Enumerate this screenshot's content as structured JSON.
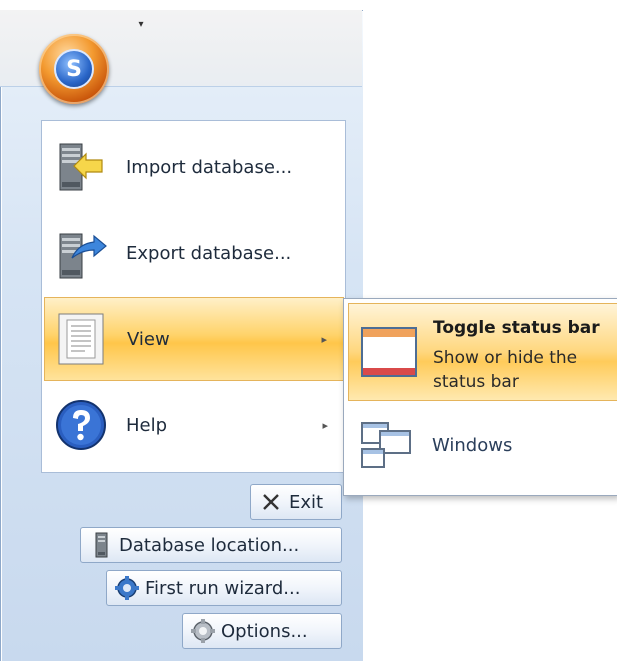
{
  "quick_access": {
    "dropdown_glyph": "▾"
  },
  "app_button": {
    "logo": "S"
  },
  "menu": {
    "items": [
      {
        "label": "Import database...",
        "icon": "import-database-icon"
      },
      {
        "label": "Export database...",
        "icon": "export-database-icon"
      },
      {
        "label": "View",
        "icon": "view-document-icon",
        "has_submenu": true,
        "arrow": "▸"
      },
      {
        "label": "Help",
        "icon": "help-icon",
        "has_submenu": true,
        "arrow": "▸"
      }
    ]
  },
  "bottom_buttons": {
    "exit": "Exit",
    "database_location": "Database location...",
    "first_run_wizard": "First run wizard...",
    "options": "Options..."
  },
  "submenu_view": {
    "items": [
      {
        "title": "Toggle status bar",
        "description": "Show or hide the status bar",
        "icon": "status-bar-window-icon"
      },
      {
        "title": "Windows",
        "icon": "windows-icon"
      }
    ]
  },
  "colors": {
    "highlight": "#ffc64a",
    "app_button": "#f39a30",
    "frame": "#d6e4f4"
  }
}
